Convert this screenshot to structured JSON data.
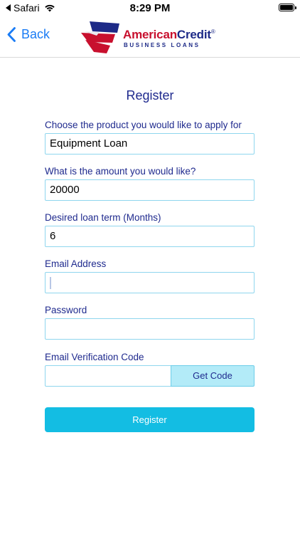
{
  "status_bar": {
    "carrier": "Safari",
    "time": "8:29 PM"
  },
  "nav": {
    "back_label": "Back"
  },
  "logo": {
    "word1": "American",
    "word2": "Credit",
    "registered": "®",
    "subtitle": "BUSINESS LOANS"
  },
  "form": {
    "title": "Register",
    "product": {
      "label": "Choose the product you would like to apply for",
      "value": "Equipment Loan"
    },
    "amount": {
      "label": "What is the amount you would like?",
      "value": "20000"
    },
    "term": {
      "label": "Desired loan term (Months)",
      "value": "6"
    },
    "email": {
      "label": "Email Address",
      "value": ""
    },
    "password": {
      "label": "Password",
      "value": ""
    },
    "verification": {
      "label": "Email Verification Code",
      "value": "",
      "button_label": "Get Code"
    },
    "submit_label": "Register"
  },
  "colors": {
    "accent_blue": "#1a7cf5",
    "label_navy": "#1f2a8e",
    "input_border": "#8fd6ee",
    "button_cyan": "#13bde3",
    "get_code_bg": "#b3ebf8",
    "logo_red": "#c8102e"
  }
}
